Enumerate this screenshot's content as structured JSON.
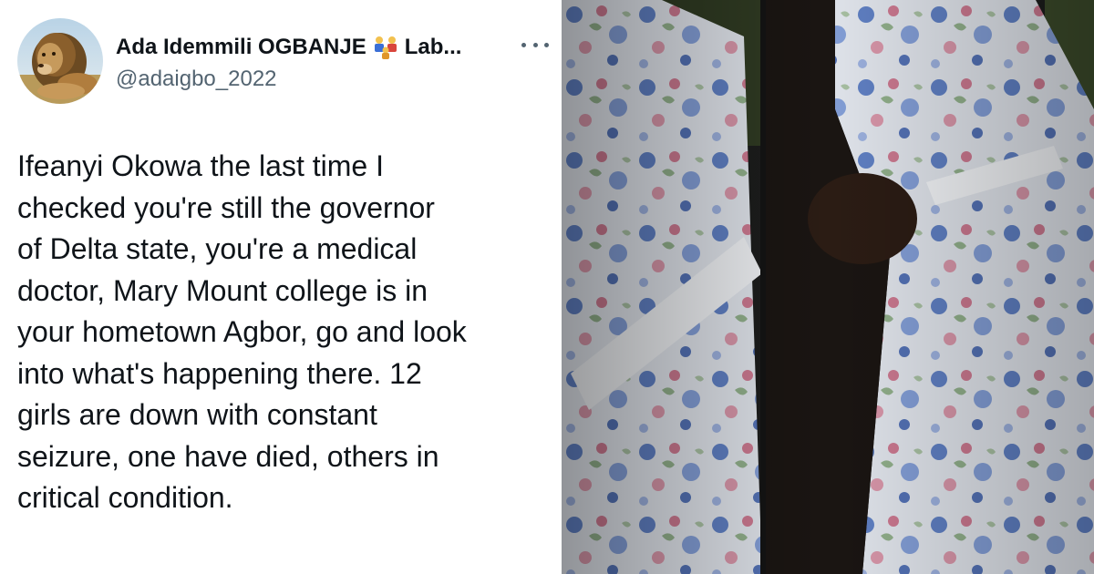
{
  "tweet": {
    "display_name": "Ada Idemmili OGBANJE",
    "display_name_suffix": "Lab...",
    "handle": "@adaigbo_2022",
    "text_lines": [
      "Ifeanyi Okowa the last time I",
      "checked you're still the governor",
      "of Delta state, you're a medical",
      "doctor, Mary Mount college is in",
      "your hometown Agbor, go and look",
      "into what's happening there. 12",
      "girls are down with constant",
      "seizure, one have died, others in",
      "critical condition."
    ]
  },
  "icons": {
    "avatar": "lion-avatar",
    "name_emoji": "family-emoji",
    "more": "more-options-icon"
  },
  "colors": {
    "name_text": "#0f1419",
    "handle_text": "#536471",
    "body_text": "#0f1419",
    "media_dark": "#1c1d1c",
    "fabric_base": "#dfe3ea"
  }
}
